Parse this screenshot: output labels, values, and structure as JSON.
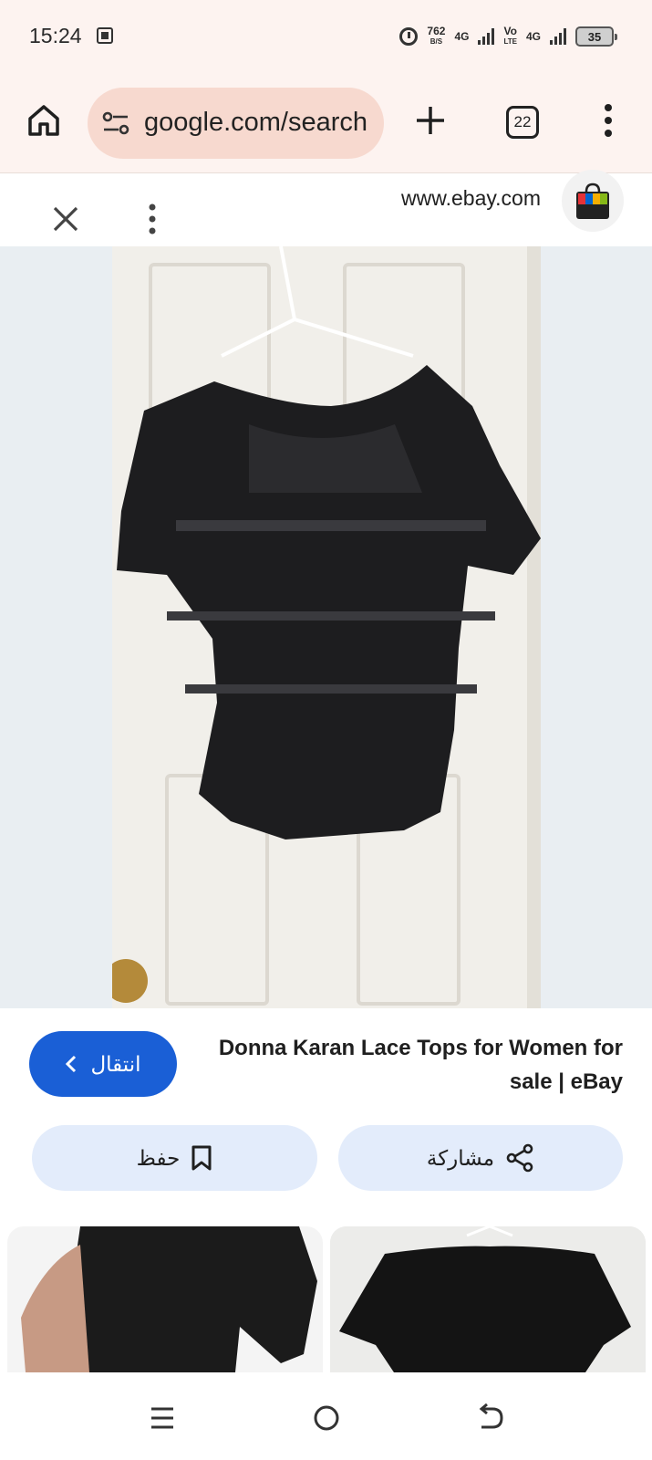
{
  "status_bar": {
    "time": "15:24",
    "net_speed_value": "762",
    "net_speed_unit": "B/S",
    "network_1": "4G",
    "volte_top": "Vo",
    "volte_bottom": "LTE",
    "network_2": "4G",
    "battery": "35"
  },
  "browser": {
    "url": "google.com/search",
    "tab_count": "22"
  },
  "viewer": {
    "source_domain": "www.ebay.com"
  },
  "result": {
    "title": "Donna Karan Lace Tops for Women for sale | eBay",
    "visit_label": "انتقال",
    "save_label": "حفظ",
    "share_label": "مشاركة"
  },
  "colors": {
    "accent": "#1a5fd6",
    "chip_bg": "#e3ecfb",
    "toolbar_bg": "#fdf3f0",
    "url_pill_bg": "#f7d9cf"
  },
  "icons": [
    "home-icon",
    "tune-icon",
    "plus-icon",
    "tabs-icon",
    "more-vert-icon",
    "close-icon",
    "ebay-bag-icon",
    "chevron-left-icon",
    "bookmark-icon",
    "share-icon",
    "recents-icon",
    "home-circle-icon",
    "back-icon"
  ]
}
